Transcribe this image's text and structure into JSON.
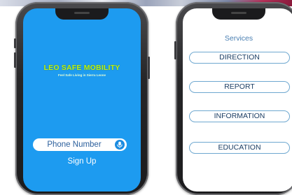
{
  "left_phone": {
    "app_name": "LEO SAFE MOBILITY",
    "tagline": "Feel Safe Living in Sierra Leone",
    "phone_field_placeholder": "Phone Number",
    "mic_icon": "microphone-icon",
    "signup_label": "Sign Up",
    "screen_color": "#1d9bf0",
    "title_color": "#b8f21c"
  },
  "right_phone": {
    "title": "Services",
    "items": [
      {
        "label": "DIRECTION"
      },
      {
        "label": "REPORT"
      },
      {
        "label": "INFORMATION"
      },
      {
        "label": "EDUCATION"
      }
    ],
    "border_color": "#6fa8d0"
  }
}
